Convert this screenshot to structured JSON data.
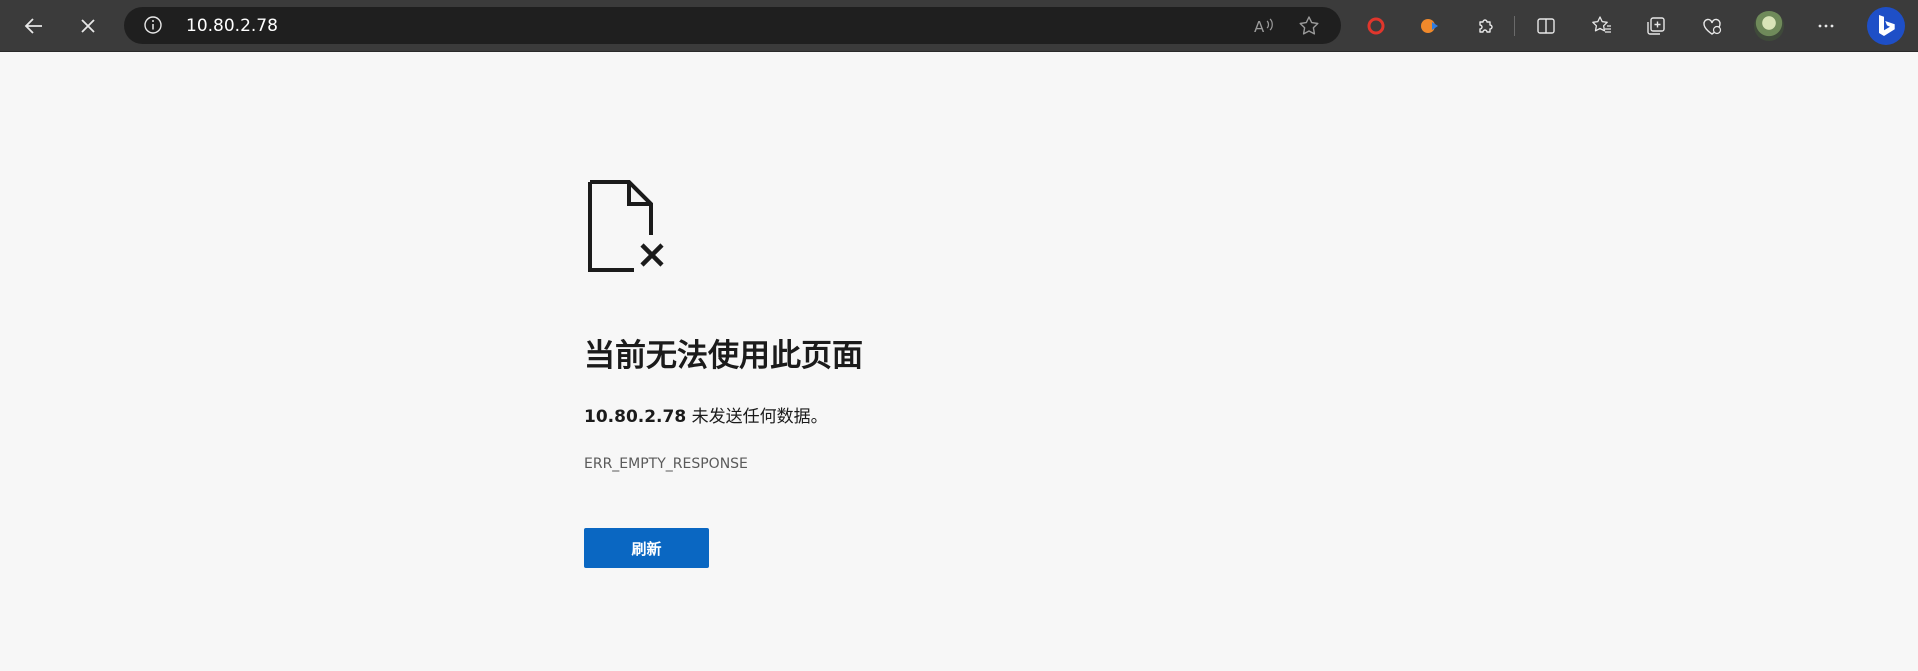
{
  "browser": {
    "url": "10.80.2.78",
    "toolbar_icons": [
      "back-arrow-icon",
      "stop-loading-icon",
      "site-info-icon",
      "read-aloud-icon",
      "favorite-star-icon",
      "extension-red-ring-icon",
      "extension-orange-icon",
      "extensions-puzzle-icon",
      "split-screen-icon",
      "favorites-icon",
      "collections-icon",
      "browser-essentials-icon",
      "profile-avatar",
      "more-menu-icon",
      "bing-copilot-icon"
    ]
  },
  "error_page": {
    "title": "当前无法使用此页面",
    "host": "10.80.2.78",
    "message_suffix": " 未发送任何数据。",
    "error_code": "ERR_EMPTY_RESPONSE",
    "refresh_label": "刷新"
  },
  "colors": {
    "toolbar_bg": "#3b3b3b",
    "address_bar_bg": "#1f1f1f",
    "page_bg": "#f7f7f7",
    "button_bg": "#0a67c2"
  }
}
